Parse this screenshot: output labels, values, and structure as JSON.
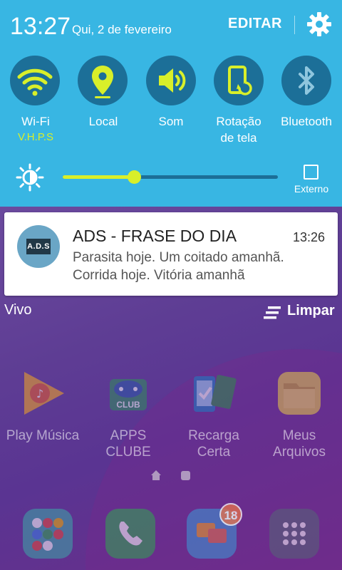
{
  "status": {
    "time": "13:27",
    "date": "Qui, 2 de fevereiro"
  },
  "header": {
    "edit_label": "EDITAR",
    "settings_icon": "gear-icon"
  },
  "toggles": [
    {
      "label": "Wi-Fi",
      "sub": "V.H.P.S",
      "icon": "wifi-icon",
      "active": true
    },
    {
      "label": "Local",
      "sub": "",
      "icon": "location-icon",
      "active": true
    },
    {
      "label": "Som",
      "sub": "",
      "icon": "sound-icon",
      "active": true
    },
    {
      "label": "Rotação\nde tela",
      "sub": "",
      "icon": "rotation-icon",
      "active": true
    },
    {
      "label": "Bluetooth",
      "sub": "",
      "icon": "bluetooth-icon",
      "active": false
    }
  ],
  "brightness": {
    "level": 0.33,
    "external_label": "Externo"
  },
  "notification": {
    "avatar_text": "A.D.S",
    "title": "ADS - FRASE DO DIA",
    "time": "13:26",
    "line1": "Parasita hoje. Um coitado amanhã.",
    "line2": "Corrida hoje. Vitória amanhã"
  },
  "footer": {
    "carrier": "Vivo",
    "clear_label": "Limpar"
  },
  "apps": [
    {
      "label1": "Play Música",
      "label2": "",
      "icon": "play-music-icon"
    },
    {
      "label1": "APPS",
      "label2": "CLUBE",
      "icon": "apps-clube-icon"
    },
    {
      "label1": "Recarga",
      "label2": "Certa",
      "icon": "recarga-icon"
    },
    {
      "label1": "Meus",
      "label2": "Arquivos",
      "icon": "folder-icon"
    }
  ],
  "dock": {
    "badge_count": "18"
  },
  "colors": {
    "panel": "#38b6e3",
    "toggle_bg": "#1c6f98",
    "accent": "#d8ef2a"
  }
}
